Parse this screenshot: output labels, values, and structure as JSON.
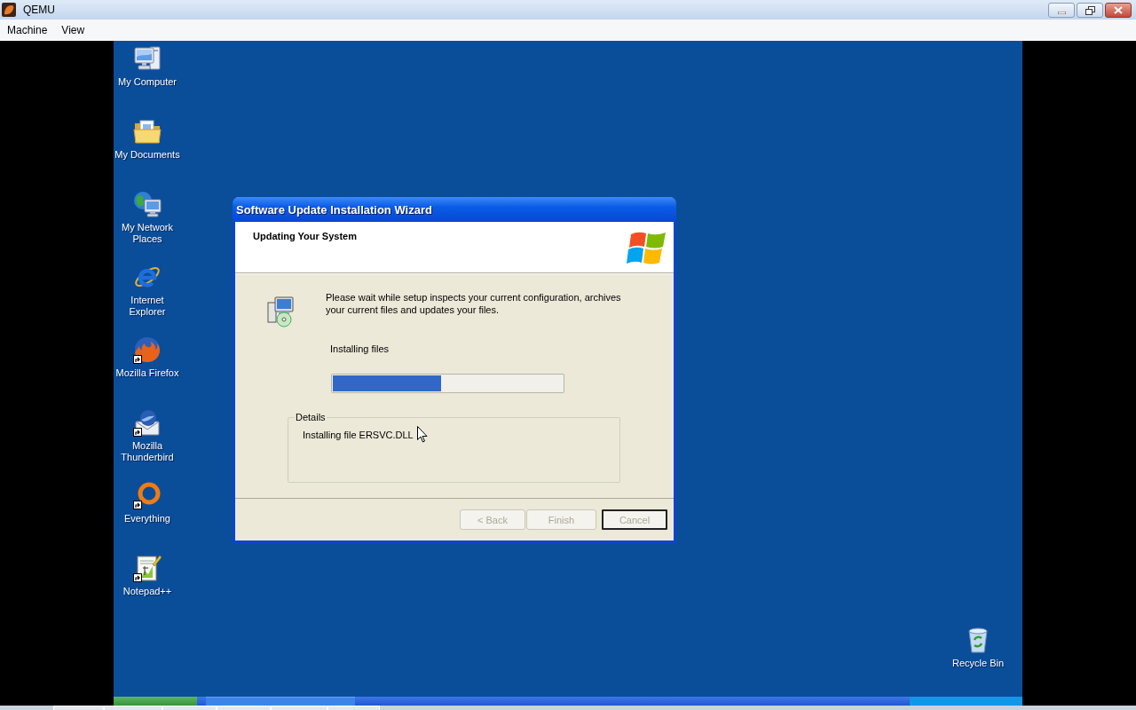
{
  "window": {
    "title": "QEMU"
  },
  "menu": [
    {
      "label": "Machine"
    },
    {
      "label": "View"
    }
  ],
  "desktop": {
    "icons": [
      {
        "kind": "computer",
        "label": "My Computer",
        "shortcut": false
      },
      {
        "kind": "documents",
        "label": "My Documents",
        "shortcut": false
      },
      {
        "kind": "network",
        "label": "My Network Places",
        "shortcut": false
      },
      {
        "kind": "ie",
        "label": "Internet Explorer",
        "shortcut": false
      },
      {
        "kind": "firefox",
        "label": "Mozilla Firefox",
        "shortcut": true
      },
      {
        "kind": "thunderbird",
        "label": "Mozilla Thunderbird",
        "shortcut": true
      },
      {
        "kind": "everything",
        "label": "Everything",
        "shortcut": true
      },
      {
        "kind": "notepad",
        "label": "Notepad++",
        "shortcut": true
      }
    ],
    "recycle_bin": {
      "kind": "recycle",
      "label": "Recycle Bin",
      "shortcut": false
    }
  },
  "dialog": {
    "title": "Software Update Installation Wizard",
    "heading": "Updating Your System",
    "message": "Please wait while setup inspects your current configuration, archives your current files and updates your files.",
    "status": "Installing files",
    "progress": {
      "level": 0.47
    },
    "details": {
      "legend": "Details",
      "text": "Installing file ERSVC.DLL"
    },
    "buttons": [
      {
        "label": "< Back",
        "disabled": true,
        "default": false
      },
      {
        "label": "Finish",
        "disabled": true,
        "default": false
      },
      {
        "label": "Cancel",
        "disabled": true,
        "default": true
      }
    ]
  }
}
